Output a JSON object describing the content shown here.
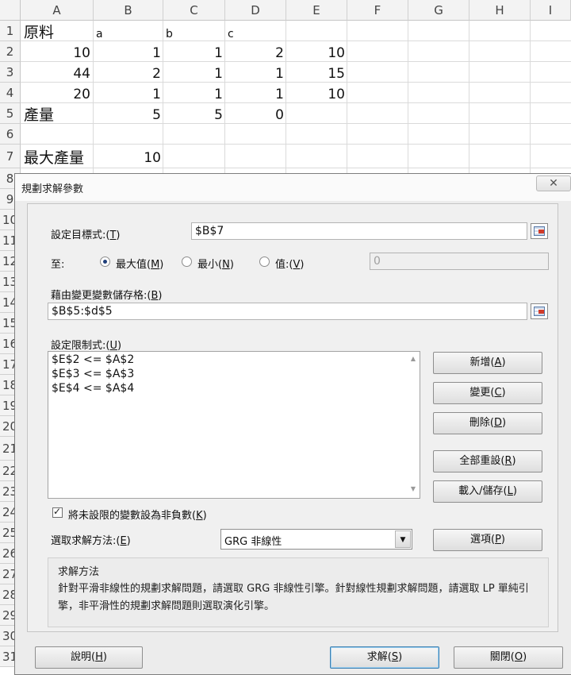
{
  "sheet": {
    "columns": [
      "A",
      "B",
      "C",
      "D",
      "E",
      "F",
      "G",
      "H",
      "I"
    ],
    "rows": [
      "1",
      "2",
      "3",
      "4",
      "5",
      "6",
      "7",
      "8",
      "9",
      "10",
      "11",
      "12",
      "13",
      "14",
      "15",
      "16",
      "17",
      "18",
      "19",
      "20",
      "21",
      "22",
      "23",
      "24",
      "25",
      "26",
      "27",
      "28",
      "29",
      "30",
      "31"
    ],
    "cells": {
      "a1": "原料",
      "b1": "a",
      "c1": "b",
      "d1": "c",
      "a2": "10",
      "b2": "1",
      "c2": "1",
      "d2": "2",
      "e2": "10",
      "a3": "44",
      "b3": "2",
      "c3": "1",
      "d3": "1",
      "e3": "15",
      "a4": "20",
      "b4": "1",
      "c4": "1",
      "d4": "1",
      "e4": "10",
      "a5": "產量",
      "b5": "5",
      "c5": "5",
      "d5": "0",
      "a7": "最大產量",
      "b7": "10"
    }
  },
  "dialog": {
    "title": "規劃求解參數",
    "close_icon": "✕",
    "objective": {
      "label": "設定目標式:(",
      "key": "T",
      "label_end": ")",
      "value": "$B$7"
    },
    "to": {
      "label": "至:",
      "max": {
        "text": "最大值(",
        "key": "M",
        "end": ")",
        "selected": true
      },
      "min": {
        "text": "最小(",
        "key": "N",
        "end": ")"
      },
      "value": {
        "text": "值:(",
        "key": "V",
        "end": ")"
      },
      "value_input": "0"
    },
    "changing": {
      "label": "藉由變更變數儲存格:(",
      "key": "B",
      "label_end": ")",
      "value": "$B$5:$d$5"
    },
    "constraints": {
      "label": "設定限制式:(",
      "key": "U",
      "label_end": ")",
      "items": [
        "$E$2 <= $A$2",
        "$E$3 <= $A$3",
        "$E$4 <= $A$4"
      ]
    },
    "buttons": {
      "add": {
        "text": "新增(",
        "key": "A",
        "end": ")"
      },
      "change": {
        "text": "變更(",
        "key": "C",
        "end": ")"
      },
      "delete": {
        "text": "刪除(",
        "key": "D",
        "end": ")"
      },
      "reset": {
        "text": "全部重設(",
        "key": "R",
        "end": ")"
      },
      "load_save": {
        "text": "載入/儲存(",
        "key": "L",
        "end": ")"
      },
      "options": {
        "text": "選項(",
        "key": "P",
        "end": ")"
      },
      "help": {
        "text": "說明(",
        "key": "H",
        "end": ")"
      },
      "solve": {
        "text": "求解(",
        "key": "S",
        "end": ")"
      },
      "close": {
        "text": "關閉(",
        "key": "O",
        "end": ")"
      }
    },
    "nonneg": {
      "text": "將未設限的變數設為非負數(",
      "key": "K",
      "end": ")",
      "checked": true
    },
    "method": {
      "label": "選取求解方法:(",
      "key": "E",
      "label_end": ")",
      "value": "GRG 非線性"
    },
    "description": {
      "title": "求解方法",
      "text": "針對平滑非線性的規劃求解問題，請選取 GRG 非線性引擎。針對線性規劃求解問題，請選取 LP 單純引擎，非平滑性的規劃求解問題則選取演化引擎。"
    }
  }
}
